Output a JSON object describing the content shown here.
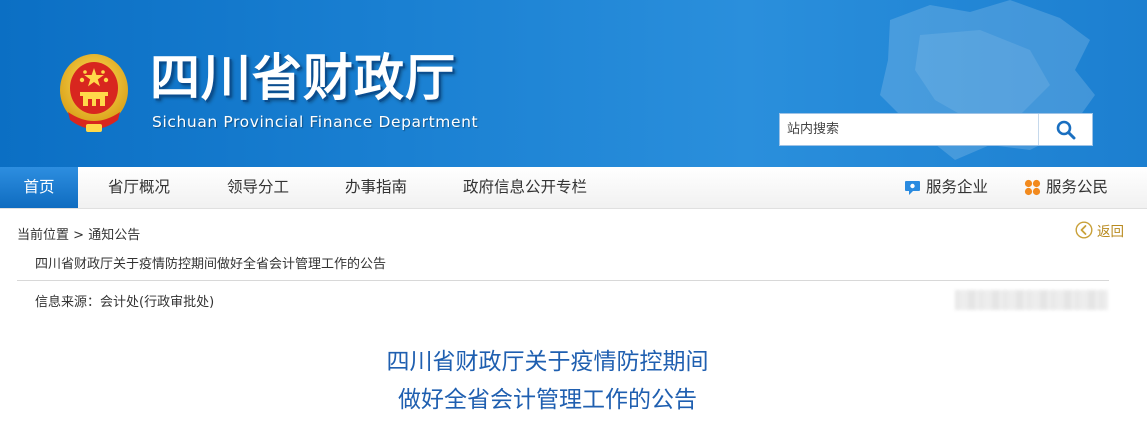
{
  "header": {
    "title": "四川省财政厅",
    "subtitle": "Sichuan Provincial Finance Department",
    "search": {
      "placeholder": "站内搜索",
      "value": ""
    }
  },
  "nav": {
    "items": [
      {
        "label": "首页",
        "active": true
      },
      {
        "label": "省厅概况"
      },
      {
        "label": "领导分工"
      },
      {
        "label": "办事指南"
      },
      {
        "label": "政府信息公开专栏"
      }
    ],
    "service_enterprise": "服务企业",
    "service_citizen": "服务公民"
  },
  "content": {
    "breadcrumb": {
      "prefix": "当前位置",
      "separator": " > ",
      "current": "通知公告"
    },
    "back_label": "返回",
    "doc_title_small": "四川省财政厅关于疫情防控期间做好全省会计管理工作的公告",
    "source": "信息来源：会计处(行政审批处)",
    "title_line1": "四川省财政厅关于疫情防控期间",
    "title_line2": "做好全省会计管理工作的公告"
  },
  "colors": {
    "banner_blue": "#1a80d2",
    "nav_active": "#1a7ad0",
    "title_blue": "#1f5fb0",
    "back_gold": "#b88a1e"
  }
}
